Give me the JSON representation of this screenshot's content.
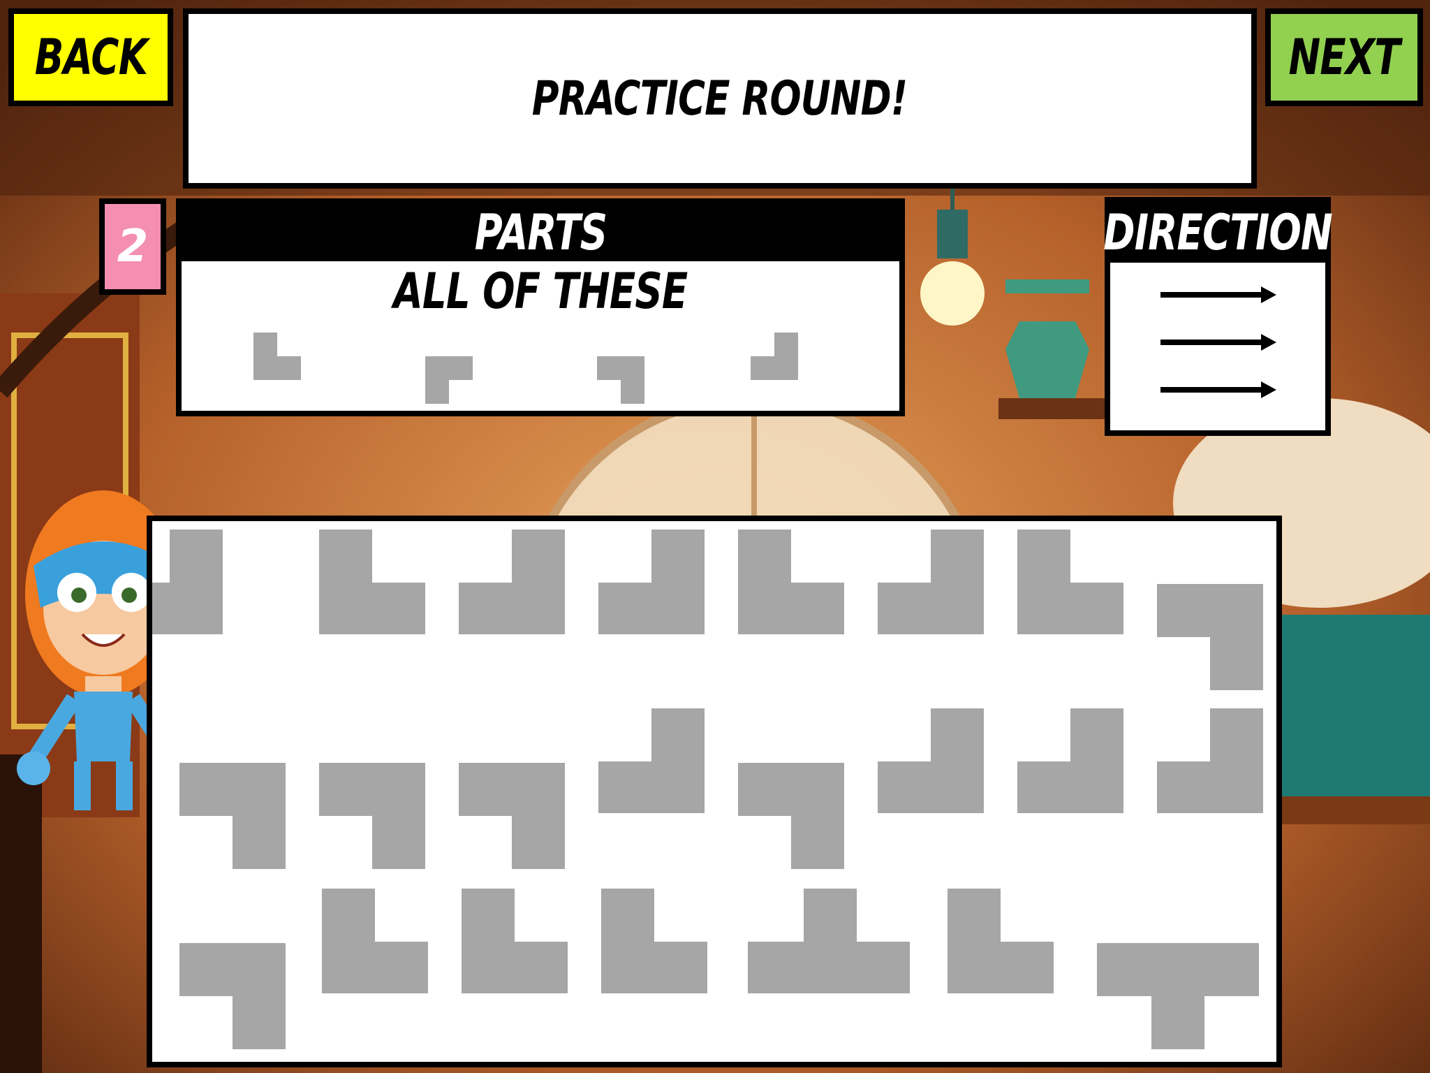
{
  "nav": {
    "back_label": "BACK",
    "next_label": "NEXT"
  },
  "title": "PRACTICE ROUND!",
  "round_badge": "2",
  "parts": {
    "heading": "PARTS",
    "subheading": "ALL OF THESE"
  },
  "direction": {
    "heading": "DIRECTION",
    "arrow_count": 3
  },
  "colors": {
    "back": "#ffff00",
    "next": "#92d050",
    "badge": "#f48fb1",
    "piece": "#a6a6a6"
  }
}
